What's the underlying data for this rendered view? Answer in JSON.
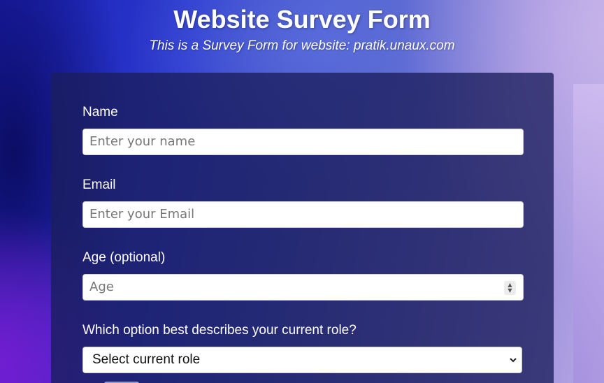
{
  "header": {
    "title": "Website Survey Form",
    "subtitle": "This is a Survey Form for website: pratik.unaux.com"
  },
  "form": {
    "name": {
      "label": "Name",
      "placeholder": "Enter your name"
    },
    "email": {
      "label": "Email",
      "placeholder": "Enter your Email"
    },
    "age": {
      "label": "Age (optional)",
      "placeholder": "Age"
    },
    "role": {
      "label": "Which option best describes your current role?",
      "selected": "Select current role"
    }
  },
  "icons": {
    "spinner": "number-spinner-icon",
    "select_arrow": "chevron-down-icon"
  },
  "colors": {
    "card_background": "#1b1e5c",
    "text": "#ffffff",
    "input_background": "#ffffff"
  }
}
